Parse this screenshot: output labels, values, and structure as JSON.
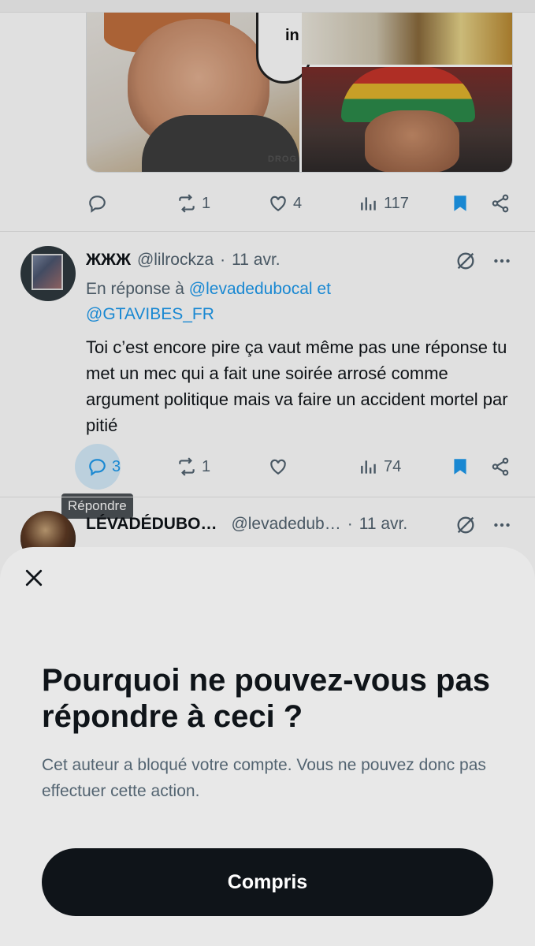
{
  "tweet1": {
    "media_bubble_text": "in",
    "media_watermark": "DROG",
    "actions": {
      "retweets": "1",
      "likes": "4",
      "views": "117"
    }
  },
  "tweet2": {
    "display_name": "ЖЖЖ",
    "handle": "@lilrockza",
    "separator": "·",
    "date": "11 avr.",
    "reply_prefix": "En réponse à",
    "reply_mention1": "@levadedubocal",
    "reply_and": "et",
    "reply_mention2": "@GTAVIBES_FR",
    "text": "Toi c’est encore pire ça vaut même pas une réponse tu met un mec qui a fait une soirée arrosé comme argument politique mais va faire un accident mortel par pitié",
    "actions": {
      "replies": "3",
      "retweets": "1",
      "likes": "",
      "views": "74"
    },
    "tooltip": "Répondre"
  },
  "tweet3": {
    "display_name": "LÉVADÉDUBO…",
    "handle": "@levadedub…",
    "separator": "·",
    "date": "11 avr."
  },
  "sheet": {
    "title": "Pourquoi ne pouvez-vous pas répondre à ceci ?",
    "description": "Cet auteur a bloqué votre compte. Vous ne pouvez donc pas effectuer cette action.",
    "confirm_label": "Compris"
  },
  "colors": {
    "accent": "#1d9bf0",
    "text_primary": "#0f1419",
    "text_secondary": "#536471",
    "sheet_bg": "#e8e8e8",
    "button_bg": "#0f1419"
  },
  "icons": [
    "reply-icon",
    "retweet-icon",
    "like-icon",
    "views-icon",
    "bookmark-icon",
    "share-icon",
    "grok-icon",
    "more-icon",
    "close-icon"
  ]
}
